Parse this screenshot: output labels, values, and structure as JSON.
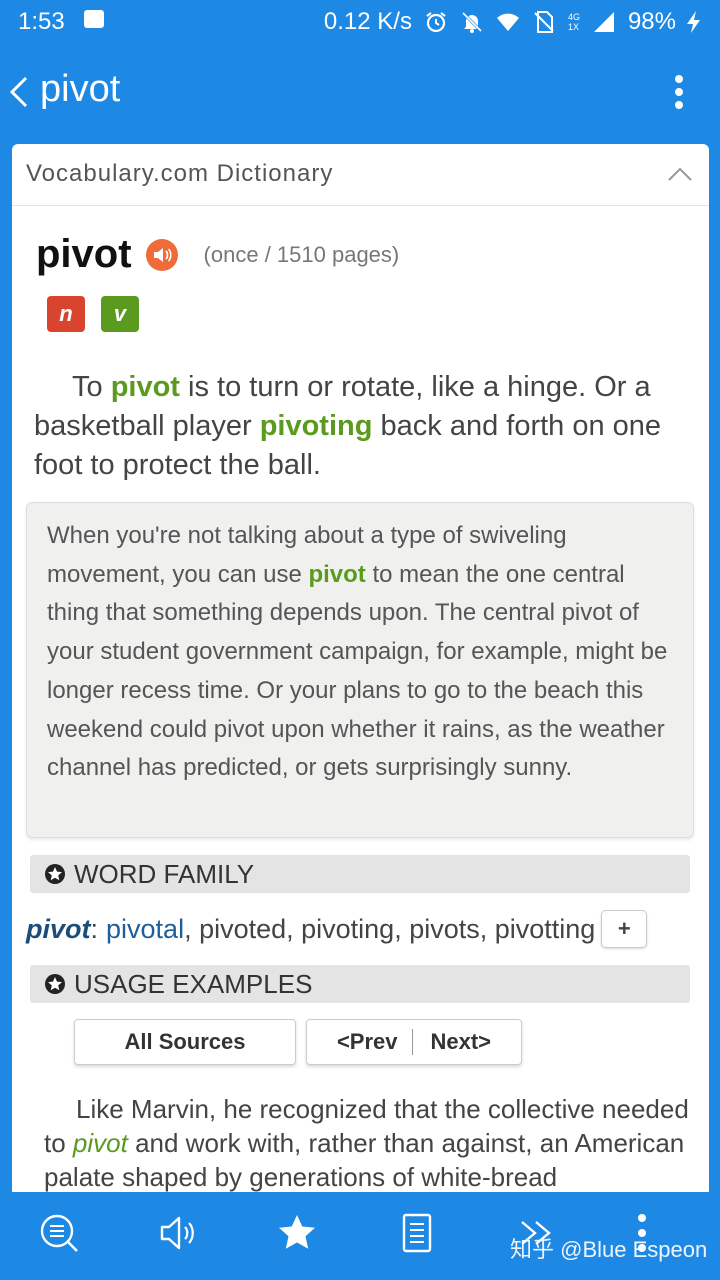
{
  "status_bar": {
    "time": "1:53",
    "net_speed": "0.12 K/s",
    "network_label": "4G 1X",
    "battery": "98%",
    "icons": [
      "gallery-icon",
      "alarm-icon",
      "notifications-off-icon",
      "wifi-icon",
      "no-sim-icon",
      "signal-icon",
      "charging-icon"
    ]
  },
  "app_bar": {
    "title": "pivot",
    "icons": [
      "back-icon",
      "more-vert-icon"
    ]
  },
  "dictionary": {
    "source": "Vocabulary.com Dictionary",
    "word": "pivot",
    "frequency": "(once / 1510 pages)",
    "pos_tags": [
      "n",
      "v"
    ],
    "short_def": {
      "p1": "To ",
      "h1": "pivot",
      "p2": " is to turn or rotate, like a hinge. Or a basketball player ",
      "h2": "pivoting",
      "p3": " back and forth on one foot to protect the ball."
    },
    "long_def": {
      "p1": "When you're not talking about a type of swiveling movement, you can use ",
      "h1": "pivot",
      "p2": " to mean the one central thing that something depends upon. The central pivot of your student government campaign, for example, might be longer recess time. Or your plans to go to the beach this weekend could pivot upon whether it rains, as the weather channel has predicted, or gets surprisingly sunny."
    }
  },
  "word_family": {
    "heading": "WORD FAMILY",
    "head_word": "pivot",
    "colon": ":",
    "link_word": "pivotal",
    "others": ", pivoted, pivoting, pivots, pivotting",
    "expand_label": "+"
  },
  "usage": {
    "heading": "USAGE EXAMPLES",
    "all_sources_label": "All Sources",
    "prev_label": "<Prev",
    "next_label": "Next>",
    "example": {
      "p1": "Like Marvin, he recognized that the collective needed to ",
      "em": "pivot",
      "p2": " and work with, rather than against, an American palate shaped by generations of white-bread"
    }
  },
  "bottom_bar": {
    "icons": [
      "search-list-icon",
      "speaker-icon",
      "star-icon",
      "document-icon",
      "forward-icon",
      "more-icon"
    ],
    "watermark": "知乎 @Blue Espeon"
  },
  "colors": {
    "primary": "#1e88e5",
    "highlight_green": "#5a9a1f",
    "noun_red": "#d9442f",
    "speaker_orange": "#ef6b3a"
  }
}
